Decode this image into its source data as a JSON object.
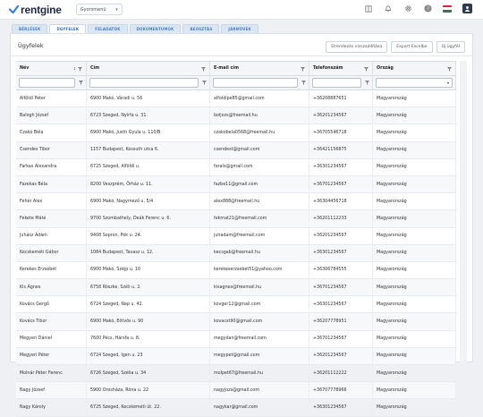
{
  "app": {
    "brand": "rentgine"
  },
  "topbar": {
    "menu_label": "Gyorsmenü"
  },
  "tabs": [
    {
      "label": "BÉRLÉSEK",
      "active": false
    },
    {
      "label": "ÜGYFELEK",
      "active": true
    },
    {
      "label": "FELADATOK",
      "active": false
    },
    {
      "label": "DOKUMENTUMOK",
      "active": false
    },
    {
      "label": "BEOSZTÁS",
      "active": false
    },
    {
      "label": "JÁRMŰVEK",
      "active": false
    }
  ],
  "page": {
    "title": "Ügyfelek",
    "actions": {
      "reset": "Elrendezés visszaállítása",
      "export": "Export Excelbe",
      "new": "Új ügyfél"
    }
  },
  "grid": {
    "columns": {
      "name": "Név",
      "address": "Cím",
      "email": "E-mail cím",
      "phone": "Telefonszám",
      "country": "Ország"
    },
    "rows": [
      [
        "Alföldi Péter",
        "6900 Makó, Váradi u. 56",
        "alfoldipe85@gmail.com",
        "+36208887651",
        "Magyarország"
      ],
      [
        "Balogh József",
        "6723 Szeged, Nyírfa u. 31.",
        "boljozs@freemail.hu",
        "+36201234567",
        "Magyarország"
      ],
      [
        "Czakó Béla",
        "6900 Makó, Justh Gyula u. 110/B",
        "czakobela0568@freemail.hu",
        "+36705546718",
        "Magyarország"
      ],
      [
        "Csendes Tibor",
        "1157 Budapest, Kossuth utca 6.",
        "csendest@gmail.com",
        "+36421156875",
        "Magyarország"
      ],
      [
        "Farkas Alexandra",
        "6725 Szeged, Alföldi u.",
        "faralx@gmail.com",
        "+36301234567",
        "Magyarország"
      ],
      [
        "Fazekas Béla",
        "8200 Veszprém, Őrház u. 11.",
        "fazbe11@gmail.com",
        "+36701234567",
        "Magyarország"
      ],
      [
        "Fehér Alex",
        "6900 Makó, Nagymező u. 5/4",
        "alex888@freemail.hu",
        "+36304456718",
        "Magyarország"
      ],
      [
        "Fekete Máté",
        "9700 Szombathely, Deák Ferenc u. 6.",
        "fekmat21@freemail.com",
        "+36201112233",
        "Magyarország"
      ],
      [
        "Juhász Ádám",
        "9408 Sopron, Pók u. 24.",
        "juhadam@freemail.com",
        "+36201234567",
        "Magyarország"
      ],
      [
        "Kecskeméti Gábor",
        "1084 Budapest, Tavasz u. 12.",
        "kecsgab@freemail.hu",
        "+36301234567",
        "Magyarország"
      ],
      [
        "Kerekes Erzsébet",
        "6900 Makó, Széjp u. 10",
        "kerekeserzsebet51@yahoo.com",
        "+36306784555",
        "Magyarország"
      ],
      [
        "Kis Ágnes",
        "6758 Röszke, Széli u. 2.",
        "kisagnes@freemail.hu",
        "+36701234567",
        "Magyarország"
      ],
      [
        "Kovács Gergő",
        "6724 Szeged, Nap u. 42.",
        "kovger12@gmail.com",
        "+36301234567",
        "Magyarország"
      ],
      [
        "Kovács Tibor",
        "6900 Makó, Eötvös u. 90",
        "kovacst90@gmail.com",
        "+36207778951",
        "Magyarország"
      ],
      [
        "Megyeri Dániel",
        "7600 Pécs, Hársfa u. 8.",
        "megydan@freemail.com",
        "+36701234567",
        "Magyarország"
      ],
      [
        "Megyeri Péter",
        "6724 Szeged, Igen u. 23",
        "megypet@gmail.com",
        "+36201234567",
        "Magyarország"
      ],
      [
        "Molnár Péter Ferenc",
        "6726 Szeged, Szélia u. 34",
        "molpet67@freemail.hu",
        "+36201112222",
        "Magyarország"
      ],
      [
        "Nagy József",
        "5900 Orosháza, Róna u. 22",
        "nagyjozs@gmail.com",
        "+36707778966",
        "Magyarország"
      ],
      [
        "Nagy Károly",
        "6725 Szeged, Kecskeméti út. 22.",
        "nagykar@gmail.com",
        "+36301234567",
        "Magyarország"
      ]
    ]
  },
  "colors": {
    "accent": "#2a66ad",
    "tab_bg": "#dbe6f3",
    "flag_red": "#cd2a3e",
    "flag_green": "#436f4d"
  },
  "icons": [
    "logo-mark-icon",
    "chevron-down-icon",
    "book-icon",
    "bell-icon",
    "gear-icon",
    "help-icon",
    "flag-icon",
    "user-icon",
    "filter-icon",
    "sort-icon"
  ]
}
